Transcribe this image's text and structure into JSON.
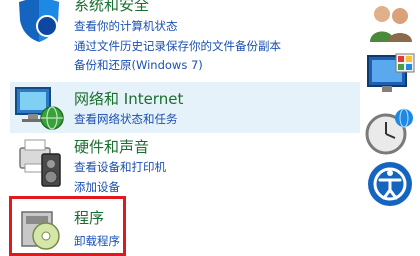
{
  "left_categories": [
    {
      "id": "system-security",
      "title": "系统和安全",
      "links": [
        "查看你的计算机状态",
        "通过文件历史记录保存你的文件备份副本",
        "备份和还原(Windows 7)"
      ]
    },
    {
      "id": "network-internet",
      "title": "网络和 Internet",
      "links": [
        "查看网络状态和任务"
      ]
    },
    {
      "id": "hardware-sound",
      "title": "硬件和声音",
      "links": [
        "查看设备和打印机",
        "添加设备"
      ]
    },
    {
      "id": "programs",
      "title": "程序",
      "links": [
        "卸载程序"
      ]
    }
  ],
  "right_icons": [
    "user-accounts-icon",
    "appearance-personalization-icon",
    "clock-region-icon",
    "ease-of-access-icon"
  ],
  "colors": {
    "title_green": "#1a6e2e",
    "link_blue": "#1a4fb3",
    "highlight_bg": "#e6f2fa",
    "red_outline": "#e0191c"
  }
}
